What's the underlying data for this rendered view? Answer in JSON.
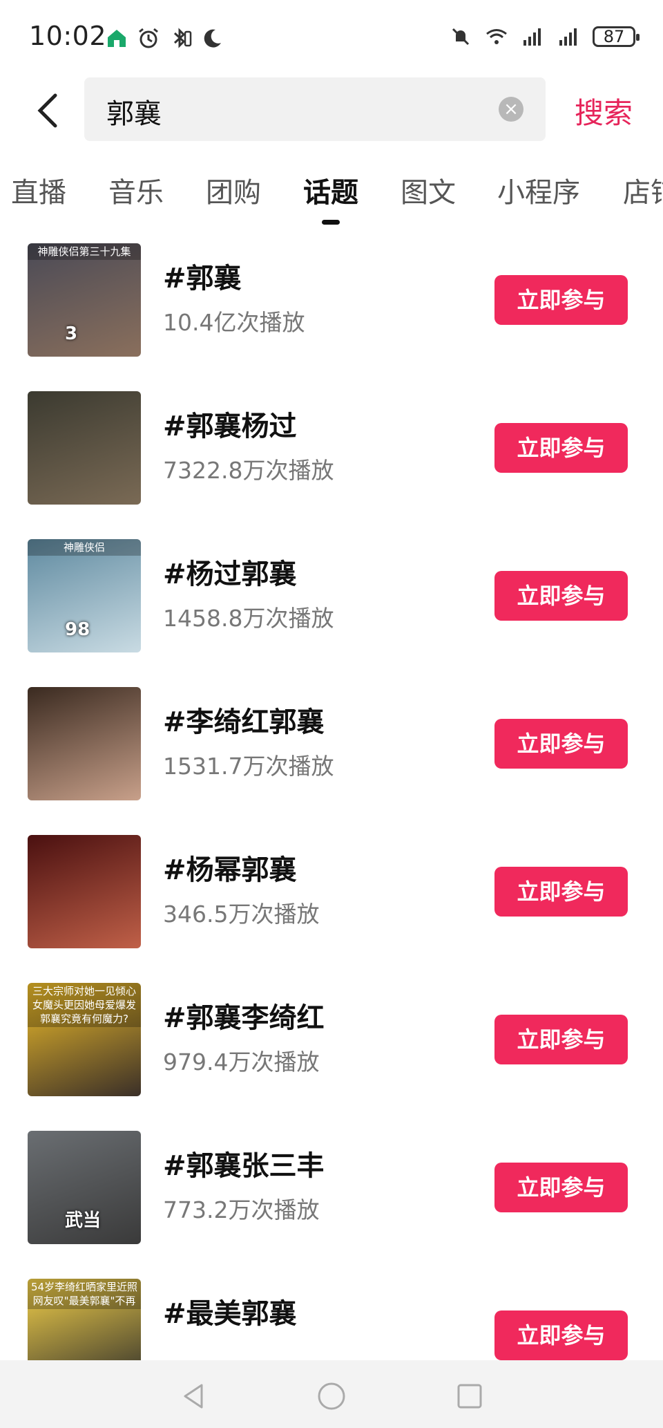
{
  "status_bar": {
    "time": "10:02",
    "battery": "87",
    "left_icons": [
      "home-badge-icon",
      "alarm-icon",
      "bluetooth-icon",
      "moon-icon"
    ],
    "right_icons": [
      "mute-icon",
      "wifi-icon",
      "signal-icon",
      "signal-icon"
    ]
  },
  "search": {
    "query": "郭襄",
    "submit_label": "搜索"
  },
  "tabs": [
    {
      "label": "直播"
    },
    {
      "label": "音乐"
    },
    {
      "label": "团购"
    },
    {
      "label": "话题",
      "active": true
    },
    {
      "label": "图文"
    },
    {
      "label": "小程序"
    },
    {
      "label": "店铺"
    }
  ],
  "topics": [
    {
      "title": "#郭襄",
      "plays": "10.4亿次播放",
      "action": "立即参与",
      "thumb_caption": "神雕侠侣第三十九集",
      "thumb_badge": "3",
      "thumb_colors": [
        "#4a4a56",
        "#8a6f5c"
      ]
    },
    {
      "title": "#郭襄杨过",
      "plays": "7322.8万次播放",
      "action": "立即参与",
      "thumb_caption": "",
      "thumb_badge": "",
      "thumb_colors": [
        "#3b3a30",
        "#7a6a55"
      ]
    },
    {
      "title": "#杨过郭襄",
      "plays": "1458.8万次播放",
      "action": "立即参与",
      "thumb_caption": "神雕侠侣",
      "thumb_badge": "98",
      "thumb_colors": [
        "#5f8aa0",
        "#c9dbe3"
      ]
    },
    {
      "title": "#李绮红郭襄",
      "plays": "1531.7万次播放",
      "action": "立即参与",
      "thumb_caption": "",
      "thumb_badge": "",
      "thumb_colors": [
        "#3a2a20",
        "#c8a08a"
      ]
    },
    {
      "title": "#杨幂郭襄",
      "plays": "346.5万次播放",
      "action": "立即参与",
      "thumb_caption": "",
      "thumb_badge": "",
      "thumb_colors": [
        "#4a1010",
        "#c06048"
      ]
    },
    {
      "title": "#郭襄李绮红",
      "plays": "979.4万次播放",
      "action": "立即参与",
      "thumb_caption": "三大宗师对她一见倾心 女魔头更因她母爱爆发 郭襄究竟有何魔力?",
      "thumb_badge": "",
      "thumb_colors": [
        "#f2c02a",
        "#3a2f28"
      ]
    },
    {
      "title": "#郭襄张三丰",
      "plays": "773.2万次播放",
      "action": "立即参与",
      "thumb_caption": "",
      "thumb_badge": "武当",
      "thumb_colors": [
        "#6a6e72",
        "#3a3a3a"
      ]
    },
    {
      "title": "#最美郭襄",
      "plays": "",
      "action": "立即参与",
      "thumb_caption": "54岁李绮红晒家里近照 网友叹\"最美郭襄\"不再",
      "thumb_badge": "",
      "thumb_colors": [
        "#f5d24a",
        "#2a2a2a"
      ]
    }
  ],
  "nav": {
    "icons": [
      "back-triangle-icon",
      "home-circle-icon",
      "recents-square-icon"
    ]
  },
  "colors": {
    "accent": "#f0295c",
    "search_text": "#e6245a"
  }
}
